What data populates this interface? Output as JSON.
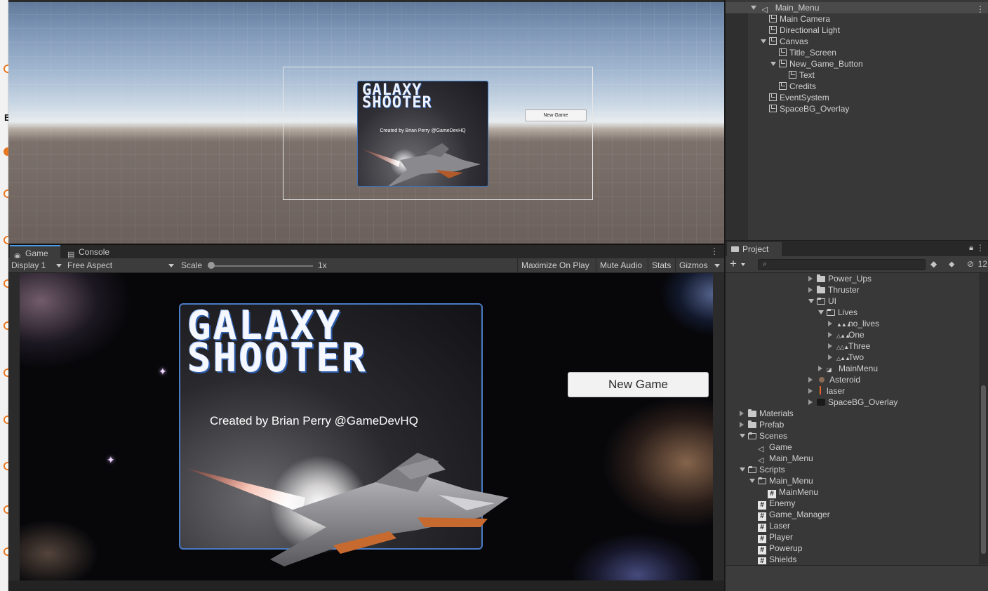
{
  "hierarchy": {
    "scene": "Main_Menu",
    "items": [
      {
        "label": "Main Camera"
      },
      {
        "label": "Directional Light"
      },
      {
        "label": "Canvas"
      },
      {
        "label": "Title_Screen"
      },
      {
        "label": "New_Game_Button"
      },
      {
        "label": "Text"
      },
      {
        "label": "Credits"
      },
      {
        "label": "EventSystem"
      },
      {
        "label": "SpaceBG_Overlay"
      }
    ]
  },
  "scene_view": {
    "title": "GALAXY\nSHOOTER",
    "credits": "Created by Brian Perry @GameDevHQ",
    "button": "New Game"
  },
  "game_panel": {
    "tabs": {
      "game": "Game",
      "console": "Console"
    },
    "toolbar": {
      "display": "Display 1",
      "aspect": "Free Aspect",
      "scale_label": "Scale",
      "scale_value": "1x",
      "maximize": "Maximize On Play",
      "mute": "Mute Audio",
      "stats": "Stats",
      "gizmos": "Gizmos"
    },
    "title": "GALAXY\nSHOOTER",
    "credits": "Created by Brian Perry @GameDevHQ",
    "new_game": "New Game"
  },
  "project": {
    "tab": "Project",
    "search_placeholder": "",
    "hidden_count": "12",
    "items": [
      {
        "label": "Power_Ups"
      },
      {
        "label": "Thruster"
      },
      {
        "label": "UI"
      },
      {
        "label": "Lives"
      },
      {
        "label": "no_lives"
      },
      {
        "label": "One"
      },
      {
        "label": "Three"
      },
      {
        "label": "Two"
      },
      {
        "label": "MainMenu"
      },
      {
        "label": "Asteroid"
      },
      {
        "label": "laser"
      },
      {
        "label": "SpaceBG_Overlay"
      },
      {
        "label": "Materials"
      },
      {
        "label": "Prefab"
      },
      {
        "label": "Scenes"
      },
      {
        "label": "Game"
      },
      {
        "label": "Main_Menu"
      },
      {
        "label": "Scripts"
      },
      {
        "label": "Main_Menu"
      },
      {
        "label": "MainMenu"
      },
      {
        "label": "Enemy"
      },
      {
        "label": "Game_Manager"
      },
      {
        "label": "Laser"
      },
      {
        "label": "Player"
      },
      {
        "label": "Powerup"
      },
      {
        "label": "Shields"
      }
    ]
  },
  "colors": {
    "accent_blue": "#4d9ce8",
    "panel_border": "#4a7bc4",
    "editor_bg": "#383838"
  }
}
